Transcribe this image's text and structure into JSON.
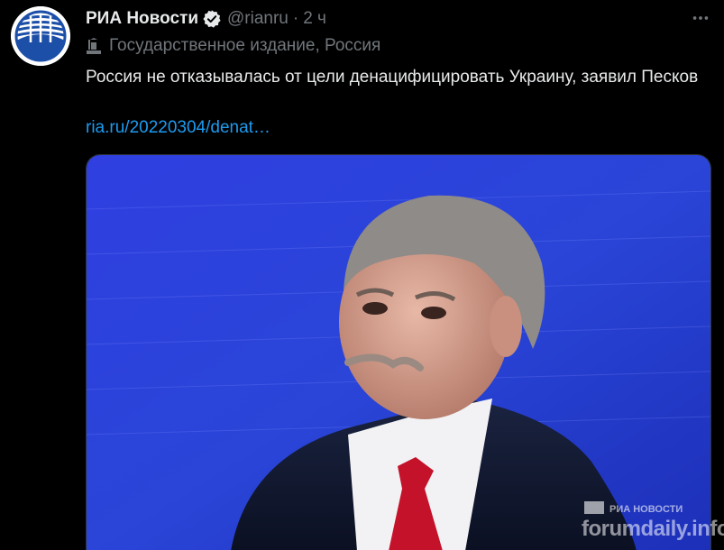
{
  "tweet": {
    "display_name": "РИА Новости",
    "handle": "@rianru",
    "separator": "·",
    "time": "2 ч",
    "affiliation": "Государственное издание, Россия",
    "text": "Россия не отказывалась от цели денацифицировать Украину, заявил Песков",
    "link": "ria.ru/20220304/denat…"
  },
  "colors": {
    "background": "#000000",
    "text_primary": "#e7e9ea",
    "text_secondary": "#71767b",
    "link": "#1d9bf0",
    "avatar_blue": "#1c4fa8"
  },
  "icons": {
    "verified": "verified-badge-icon",
    "more": "more-dots-icon",
    "affiliation": "state-media-flag-icon"
  },
  "media": {
    "photo_watermark": "РИА НОВОСТИ",
    "forum_watermark": "forumdaily.info"
  }
}
